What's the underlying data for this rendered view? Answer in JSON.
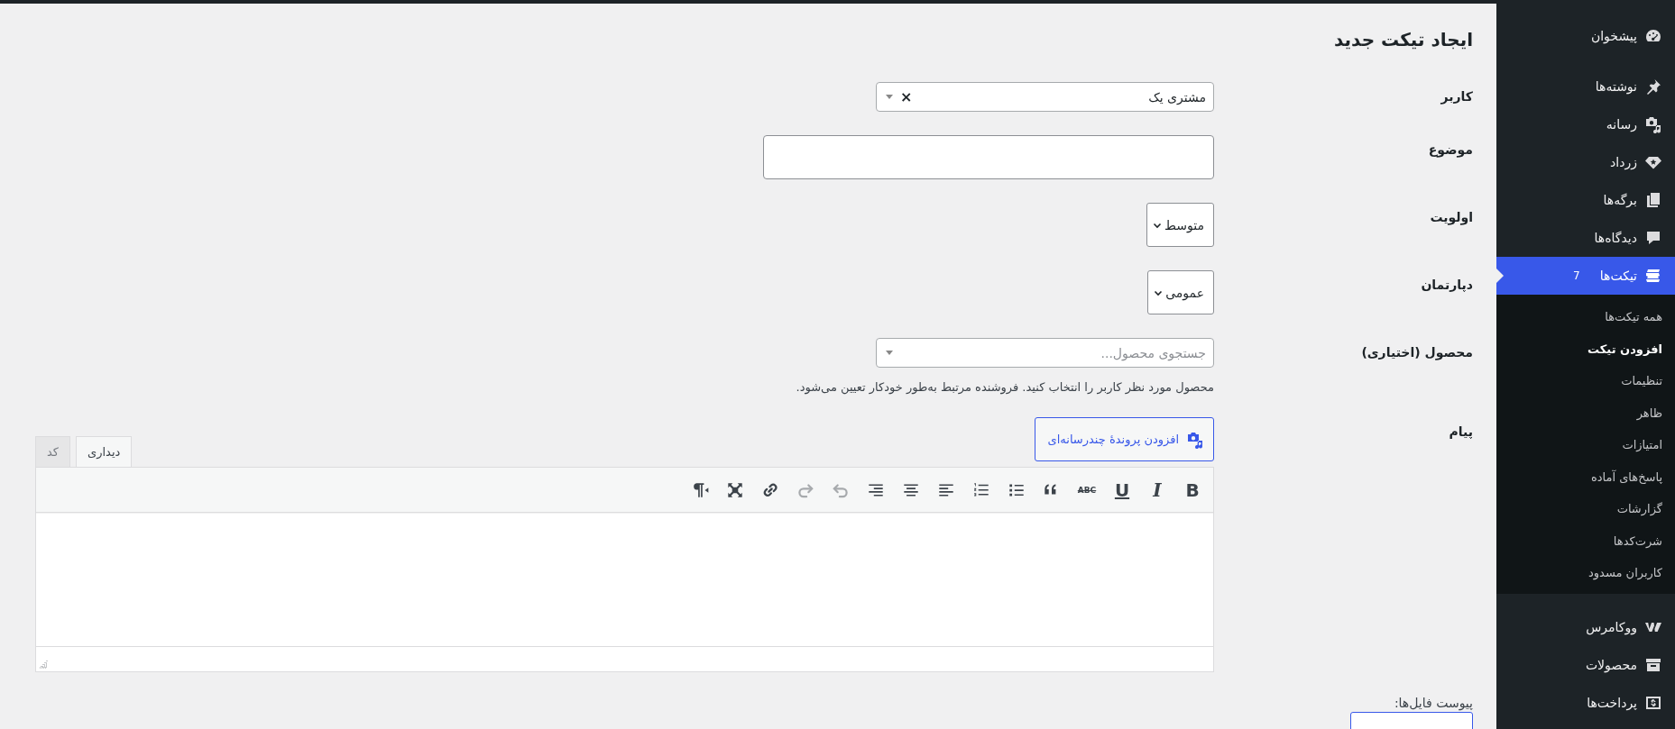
{
  "admin_menu": {
    "items": [
      {
        "kind": "dashboard",
        "label": "پیشخوان",
        "selected": false
      },
      {
        "kind": "pin",
        "label": "نوشته‌ها",
        "selected": false
      },
      {
        "kind": "media",
        "label": "رسانه",
        "selected": false
      },
      {
        "kind": "diamond",
        "label": "زرداد",
        "selected": false
      },
      {
        "kind": "pages",
        "label": "برگه‌ها",
        "selected": false
      },
      {
        "kind": "comments",
        "label": "دیدگاه‌ها",
        "selected": false
      },
      {
        "kind": "tickets",
        "label": "تیکت‌ها",
        "selected": true,
        "count": "7",
        "submenu": [
          {
            "label": "همه تیکت‌ها",
            "selected": false
          },
          {
            "label": "افزودن تیکت",
            "selected": true
          },
          {
            "label": "تنظیمات",
            "selected": false
          },
          {
            "label": "ظاهر",
            "selected": false
          },
          {
            "label": "امتیازات",
            "selected": false
          },
          {
            "label": "پاسخ‌های آماده",
            "selected": false
          },
          {
            "label": "گزارشات",
            "selected": false
          },
          {
            "label": "شرت‌کدها",
            "selected": false
          },
          {
            "label": "کاربران مسدود",
            "selected": false
          }
        ]
      },
      {
        "kind": "woo",
        "label": "ووکامرس",
        "selected": false
      },
      {
        "kind": "box",
        "label": "محصولات",
        "selected": false
      },
      {
        "kind": "payments",
        "label": "پرداخت‌ها",
        "selected": false
      }
    ]
  },
  "page_title": "ایجاد تیکت جدید",
  "form": {
    "user": {
      "label": "کاربر",
      "value": "مشتری یک",
      "clear": "×"
    },
    "subject": {
      "label": "موضوع"
    },
    "priority": {
      "label": "اولویت",
      "value": "متوسط"
    },
    "department": {
      "label": "دپارتمان",
      "value": "عمومی"
    },
    "product": {
      "label": "محصول (اختیاری)",
      "placeholder": "جستجوی محصول...",
      "help": "محصول مورد نظر کاربر را انتخاب کنید. فروشنده مرتبط به‌طور خودکار تعیین می‌شود."
    },
    "message": {
      "label": "پیام",
      "add_media": "افزودن پروندهٔ چندرسانه‌ای",
      "tabs": [
        {
          "label": "دیداری",
          "selected": true
        },
        {
          "label": "کد",
          "selected": false
        }
      ],
      "toolbar": [
        {
          "kind": "bold",
          "label": "B",
          "disabled": false
        },
        {
          "kind": "italic",
          "label": "I",
          "disabled": false
        },
        {
          "kind": "underline",
          "label": "U",
          "disabled": false
        },
        {
          "kind": "strike",
          "label": "ABC",
          "disabled": false
        },
        {
          "kind": "quote",
          "disabled": false
        },
        {
          "kind": "bullets",
          "disabled": false
        },
        {
          "kind": "numbers",
          "disabled": false
        },
        {
          "kind": "align-left",
          "disabled": false
        },
        {
          "kind": "align-center",
          "disabled": false
        },
        {
          "kind": "align-right",
          "disabled": false
        },
        {
          "kind": "undo",
          "disabled": true
        },
        {
          "kind": "redo",
          "disabled": true
        },
        {
          "kind": "link",
          "disabled": false
        },
        {
          "kind": "fullscreen",
          "disabled": false
        },
        {
          "kind": "rtl",
          "disabled": false
        }
      ]
    },
    "attachments": {
      "label": "پیوست فایل‌ها:"
    }
  }
}
